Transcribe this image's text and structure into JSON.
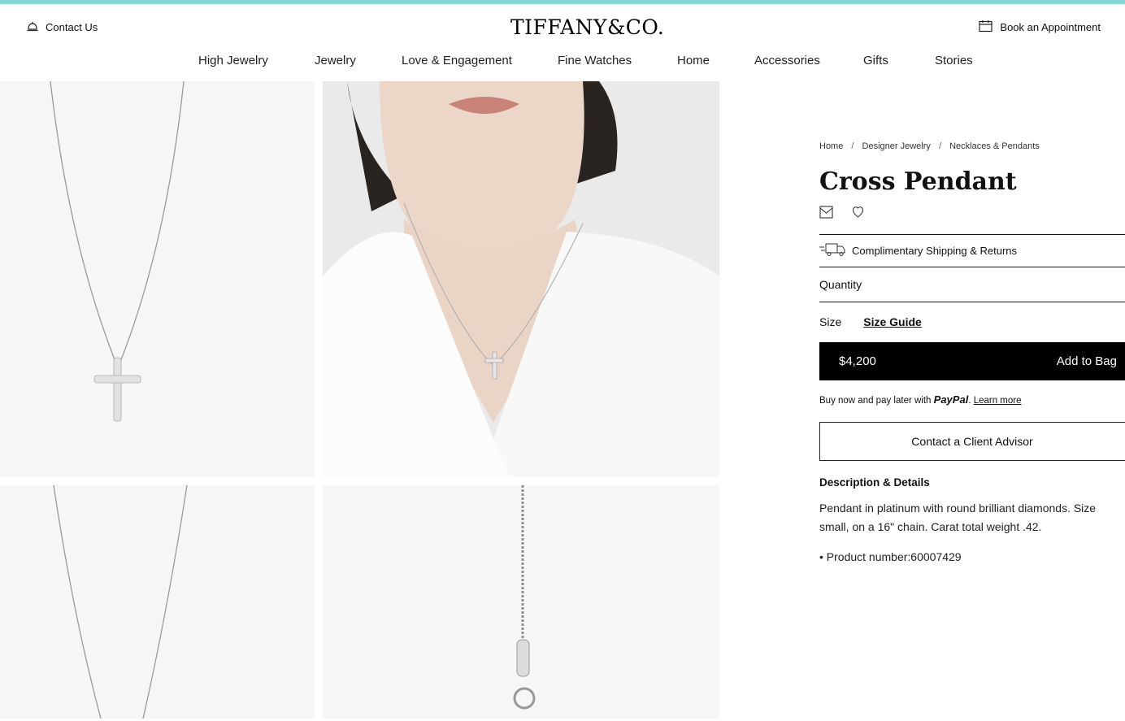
{
  "header": {
    "contact_label": "Contact Us",
    "logo_text": "TIFFANY&CO.",
    "book_label": "Book an Appointment",
    "accent_color": "#81d8d0"
  },
  "nav": {
    "items": [
      {
        "label": "High Jewelry"
      },
      {
        "label": "Jewelry"
      },
      {
        "label": "Love & Engagement"
      },
      {
        "label": "Fine Watches"
      },
      {
        "label": "Home"
      },
      {
        "label": "Accessories"
      },
      {
        "label": "Gifts"
      },
      {
        "label": "Stories"
      }
    ]
  },
  "breadcrumb": {
    "items": [
      "Home",
      "Designer Jewelry",
      "Necklaces & Pendants"
    ],
    "separator": "/"
  },
  "product": {
    "title": "Cross Pendant",
    "shipping_label": "Complimentary Shipping & Returns",
    "quantity_label": "Quantity",
    "size_label": "Size",
    "size_guide_label": "Size Guide",
    "price": "$4,200",
    "add_to_bag_label": "Add to Bag",
    "paypal_prefix": "Buy now and pay later with",
    "paypal_brand": "PayPal",
    "paypal_learn_more": "Learn more",
    "advisor_label": "Contact a Client Advisor",
    "description_title": "Description & Details",
    "description": "Pendant in platinum with round brilliant diamonds. Size small, on a 16\" chain. Carat total weight .42.",
    "product_number_label": "• Product number:",
    "product_number": "60007429"
  },
  "icons": {
    "contact": "bell-icon",
    "book": "calendar-icon",
    "shipping": "truck-icon",
    "gift": "gift-box-icon",
    "wishlist": "heart-icon"
  }
}
